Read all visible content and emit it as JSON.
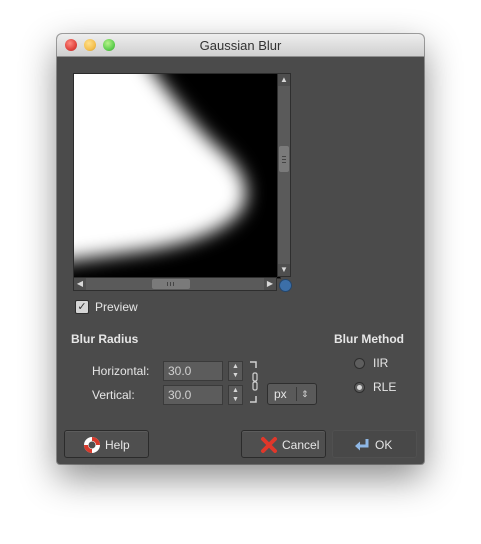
{
  "window": {
    "title": "Gaussian Blur"
  },
  "preview": {
    "label": "Preview",
    "checked": true
  },
  "blur_radius": {
    "heading": "Blur Radius",
    "horizontal_label": "Horizontal:",
    "horizontal_value": "30.0",
    "vertical_label": "Vertical:",
    "vertical_value": "30.0",
    "unit": "px"
  },
  "blur_method": {
    "heading": "Blur Method",
    "options": [
      {
        "label": "IIR",
        "selected": false
      },
      {
        "label": "RLE",
        "selected": true
      }
    ]
  },
  "buttons": {
    "help": "Help",
    "cancel": "Cancel",
    "ok": "OK"
  }
}
